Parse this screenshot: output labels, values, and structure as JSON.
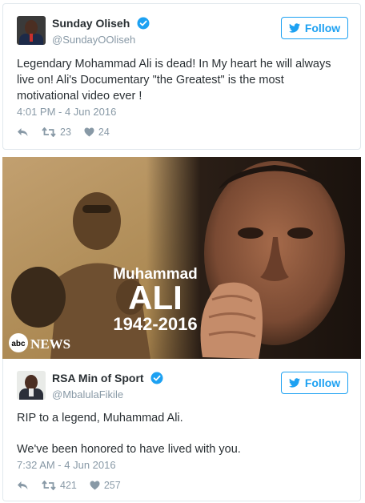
{
  "tweets": [
    {
      "display_name": "Sunday Oliseh",
      "handle": "@SundayOOliseh",
      "follow_label": "Follow",
      "text": "Legendary Mohammad Ali is dead! In My heart he will always live on! Ali's Documentary \"the Greatest\" is the most motivational video ever !",
      "timestamp": "4:01 PM - 4 Jun 2016",
      "retweets": "23",
      "likes": "24"
    },
    {
      "display_name": "RSA Min of Sport",
      "handle": "@MbalulaFikile",
      "follow_label": "Follow",
      "text_line1": "RIP to a legend, Muhammad Ali.",
      "text_line2": "We've been honored to have lived with you.",
      "timestamp": "7:32 AM - 4 Jun 2016",
      "retweets": "421",
      "likes": "257"
    }
  ],
  "photo": {
    "title_line1": "Muhammad",
    "title_line2": "ALI",
    "years": "1942-2016",
    "network_logo": "abc",
    "network_name": "NEWS"
  },
  "colors": {
    "twitter_blue": "#1da1f2",
    "muted_gray": "#8899a6",
    "text": "#292f33",
    "verified": "#1da1f2"
  },
  "icons": [
    "verified-badge-icon",
    "twitter-bird-icon",
    "reply-icon",
    "retweet-icon",
    "heart-icon"
  ]
}
